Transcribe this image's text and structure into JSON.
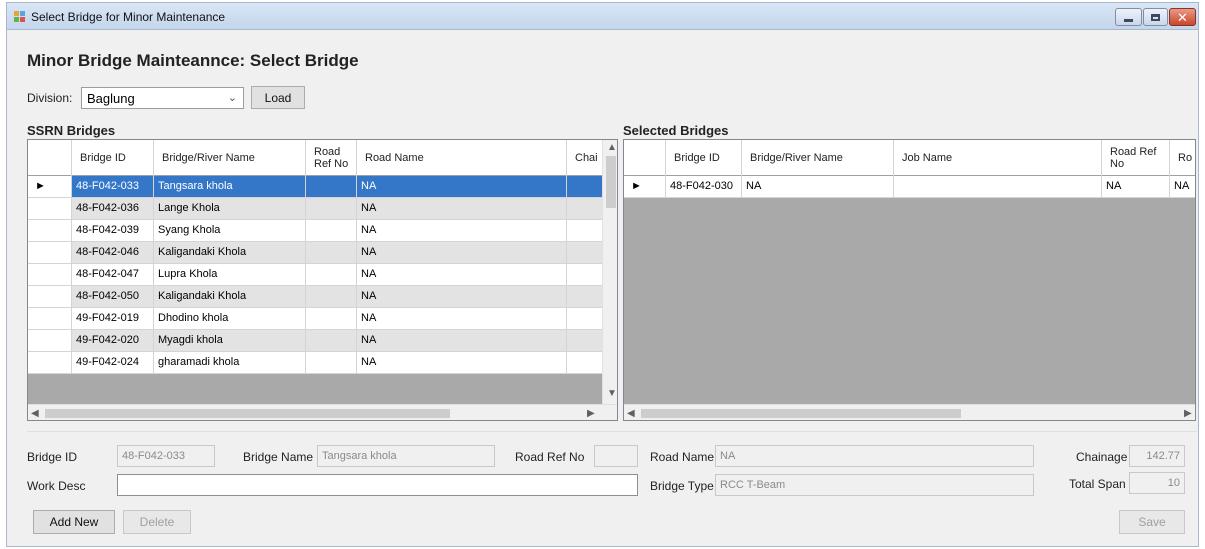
{
  "window": {
    "title": "Select Bridge for Minor Maintenance",
    "close_glyph": "✕"
  },
  "page_title": "Minor Bridge Mainteannce: Select Bridge",
  "division": {
    "label": "Division:",
    "value": "Baglung",
    "load_label": "Load"
  },
  "ssrn": {
    "title": "SSRN Bridges",
    "columns": [
      "Bridge ID",
      "Bridge/River Name",
      "Road Ref No",
      "Road Name",
      "Chai"
    ],
    "rows": [
      {
        "id": "48-F042-033",
        "name": "Tangsara khola",
        "ref": "",
        "road": "NA"
      },
      {
        "id": "48-F042-036",
        "name": "Lange Khola",
        "ref": "",
        "road": "NA"
      },
      {
        "id": "48-F042-039",
        "name": "Syang Khola",
        "ref": "",
        "road": "NA"
      },
      {
        "id": "48-F042-046",
        "name": "Kaligandaki Khola",
        "ref": "",
        "road": "NA"
      },
      {
        "id": "48-F042-047",
        "name": "Lupra Khola",
        "ref": "",
        "road": "NA"
      },
      {
        "id": "48-F042-050",
        "name": "Kaligandaki Khola",
        "ref": "",
        "road": "NA"
      },
      {
        "id": "49-F042-019",
        "name": "Dhodino khola",
        "ref": "",
        "road": "NA"
      },
      {
        "id": "49-F042-020",
        "name": "Myagdi khola",
        "ref": "",
        "road": "NA"
      },
      {
        "id": "49-F042-024",
        "name": "gharamadi khola",
        "ref": "",
        "road": "NA"
      }
    ],
    "selected_index": 0,
    "current_row_marker": "►"
  },
  "selected": {
    "title": "Selected Bridges",
    "columns": [
      "Bridge ID",
      "Bridge/River Name",
      "Job Name",
      "Road Ref No",
      "Ro"
    ],
    "rows": [
      {
        "id": "48-F042-030",
        "name": "NA",
        "job": "",
        "ref": "NA",
        "ro": "NA"
      }
    ],
    "current_row_marker": "►"
  },
  "details": {
    "bridge_id_label": "Bridge ID",
    "bridge_id": "48-F042-033",
    "bridge_name_label": "Bridge Name",
    "bridge_name": "Tangsara khola",
    "road_ref_label": "Road Ref No",
    "road_ref": "",
    "road_name_label": "Road Name",
    "road_name": "NA",
    "chainage_label": "Chainage",
    "chainage": "142.77",
    "work_desc_label": "Work Desc",
    "work_desc": "",
    "bridge_type_label": "Bridge Type",
    "bridge_type": "RCC T-Beam",
    "total_span_label": "Total Span",
    "total_span": "10"
  },
  "actions": {
    "add_new": "Add New",
    "delete": "Delete",
    "save": "Save"
  },
  "icons": {
    "dropdown": "chevron-down-icon",
    "scroll_up": "chevron-up-icon",
    "scroll_down": "chevron-down-icon",
    "scroll_left": "chevron-left-icon",
    "scroll_right": "chevron-right-icon"
  },
  "colors": {
    "selection": "#3477c8",
    "grid_background": "#a9a9a9",
    "alt_row": "#e3e3e3"
  }
}
